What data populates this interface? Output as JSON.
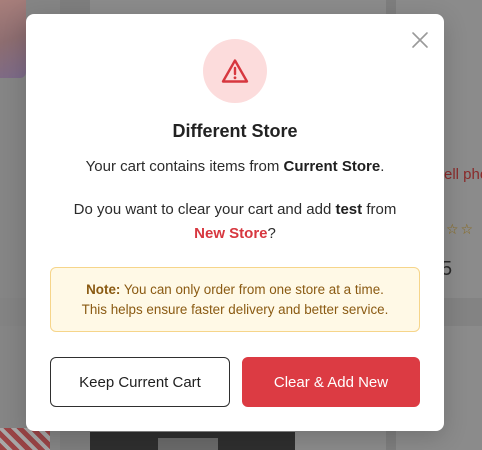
{
  "background": {
    "link_text": "ell pho",
    "stars": "☆☆",
    "price_digit": "5"
  },
  "modal": {
    "title": "Different Store",
    "line1_prefix": "Your cart contains items from ",
    "current_store": "Current Store",
    "line1_suffix": ".",
    "line2_prefix": "Do you want to clear your cart and add ",
    "product": "test",
    "line2_mid": " from",
    "new_store": "New Store",
    "line2_suffix": "?",
    "note_label": "Note:",
    "note_text_1": " You can only order from one store at a time.",
    "note_text_2": "This helps ensure faster delivery and better service.",
    "keep_button": "Keep Current Cart",
    "clear_button": "Clear & Add New"
  },
  "icons": {
    "warning": "warning-triangle-icon",
    "close": "close-icon"
  },
  "colors": {
    "accent_red": "#dc3b43",
    "warning_bg": "#fcdcdc",
    "note_bg": "#fff9e6",
    "note_border": "#f6d58a",
    "note_text": "#8a5a12"
  }
}
